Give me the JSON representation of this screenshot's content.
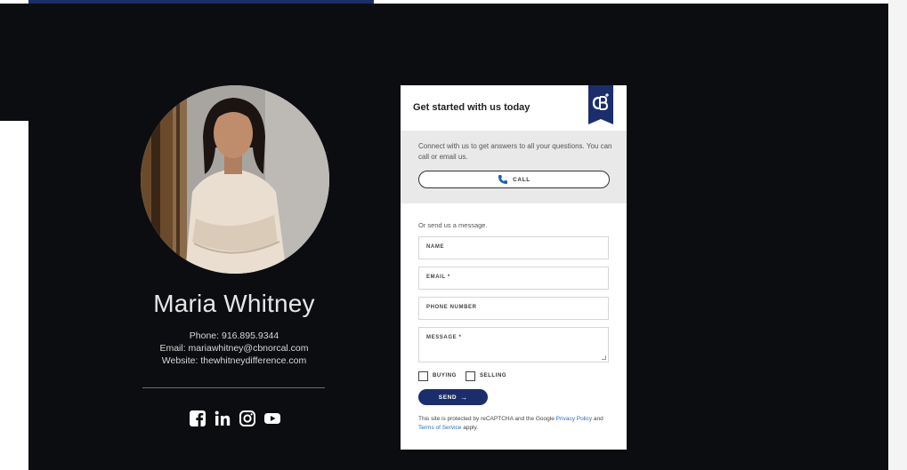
{
  "agent": {
    "name": "Maria Whitney",
    "phone": "Phone: 916.895.9344",
    "email": "Email: mariawhitney@cbnorcal.com",
    "website": "Website: thewhitneydifference.com"
  },
  "social": [
    "facebook-icon",
    "linkedin-icon",
    "instagram-icon",
    "youtube-icon"
  ],
  "form": {
    "title": "Get started with us today",
    "call_intro": "Connect with us to get answers to all your questions. You can call or email us.",
    "call_label": "CALL",
    "message_intro": "Or send us a message.",
    "fields": {
      "name": "NAME",
      "email": "EMAIL *",
      "phone": "PHONE NUMBER",
      "message": "MESSAGE *"
    },
    "checkboxes": {
      "buying": "BUYING",
      "selling": "SELLING"
    },
    "send_label": "SEND",
    "send_arrow": "→",
    "recaptcha": {
      "prefix": "This site is protected by reCAPTCHA and the Google ",
      "privacy": "Privacy Policy",
      "middle": " and ",
      "terms": "Terms of Service",
      "suffix": " apply."
    }
  },
  "colors": {
    "dark_background": "#0c0d10",
    "brand_navy": "#1b2d6b",
    "link_blue": "#2a6ebb",
    "divider_gold": "#7a6b52"
  }
}
